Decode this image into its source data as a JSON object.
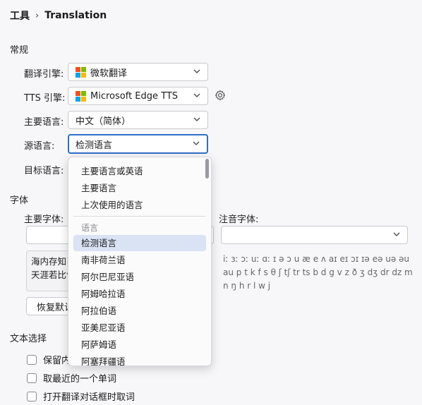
{
  "breadcrumb": {
    "parent": "工具",
    "separator": "›",
    "current": "Translation"
  },
  "general": {
    "section_title": "常规",
    "engine_label": "翻译引擎:",
    "engine_value": "微软翻译",
    "tts_label": "TTS 引擎:",
    "tts_value": "Microsoft Edge TTS",
    "primary_lang_label": "主要语言:",
    "primary_lang_value": "中文（简体）",
    "source_lang_label": "源语言:",
    "source_lang_value": "检测语言",
    "target_lang_label": "目标语言:"
  },
  "font": {
    "section_title": "字体",
    "main_font_label": "主要字体:",
    "phonetic_font_label": "注音字体:",
    "sample_line1": "海内存知己",
    "sample_line2": "天涯若比邻",
    "reset_button": "恢复默认",
    "ipa_sample": "iː ɜː ɔː uː ɑː ɪ ə ɔ u æ e ʌ aɪ eɪ ɔɪ ɪə eə uə əu au p t k f s θ ʃ tʃ tr ts b d g v z ð ʒ dʒ dr dz m n ŋ h r l w j"
  },
  "text_selection": {
    "section_title": "文本选择",
    "options": [
      "保留内容",
      "取最近的一个单词",
      "打开翻译对话框时取词"
    ]
  },
  "dropdown": {
    "top_items": [
      "主要语言或英语",
      "主要语言",
      "上次使用的语言"
    ],
    "group_label": "语言",
    "languages": [
      "检测语言",
      "南非荷兰语",
      "阿尔巴尼亚语",
      "阿姆哈拉语",
      "阿拉伯语",
      "亚美尼亚语",
      "阿萨姆语",
      "阿塞拜疆语"
    ],
    "selected": "检测语言"
  },
  "colors": {
    "accent": "#2f6fc7",
    "selection": "#d9e3f4"
  }
}
